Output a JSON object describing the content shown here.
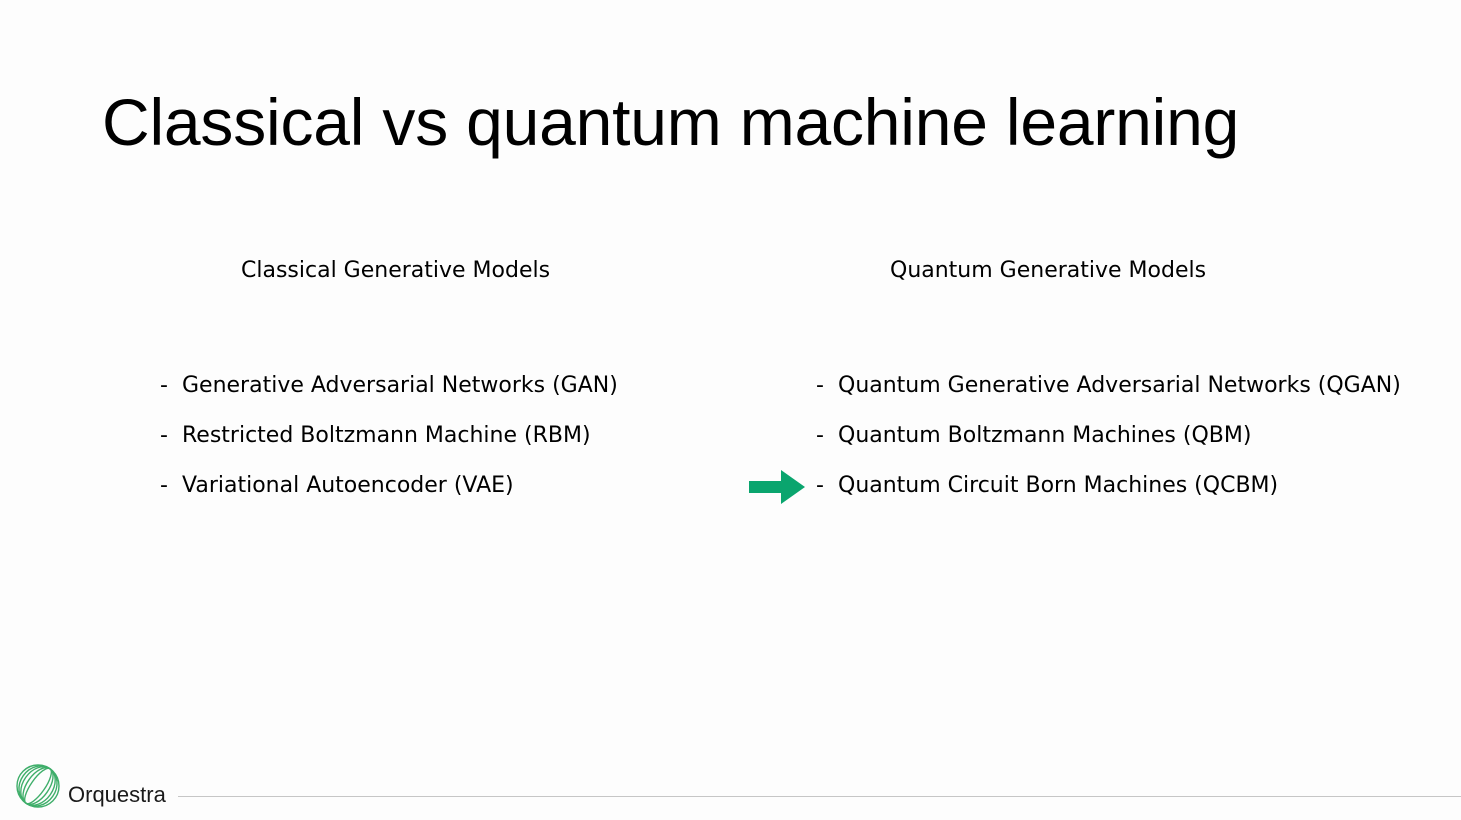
{
  "slide": {
    "title": "Classical vs quantum machine learning"
  },
  "columns": {
    "classical": {
      "heading": "Classical Generative Models",
      "items": [
        "Generative Adversarial Networks (GAN)",
        "Restricted Boltzmann Machine (RBM)",
        "Variational Autoencoder (VAE)"
      ]
    },
    "quantum": {
      "heading": "Quantum Generative Models",
      "items": [
        "Quantum Generative Adversarial Networks (QGAN)",
        "Quantum Boltzmann Machines (QBM)",
        "Quantum Circuit Born Machines (QCBM)"
      ]
    }
  },
  "bullet_marker": "-",
  "highlight": {
    "icon": "arrow-right-icon",
    "target_item": "Quantum Circuit Born Machines (QCBM)",
    "color": "#0aa56e"
  },
  "footer": {
    "brand": "Orquestra",
    "logo_icon": "orquestra-logo-icon",
    "logo_color": "#3fae6a",
    "rule_color": "#c6c6c6"
  }
}
